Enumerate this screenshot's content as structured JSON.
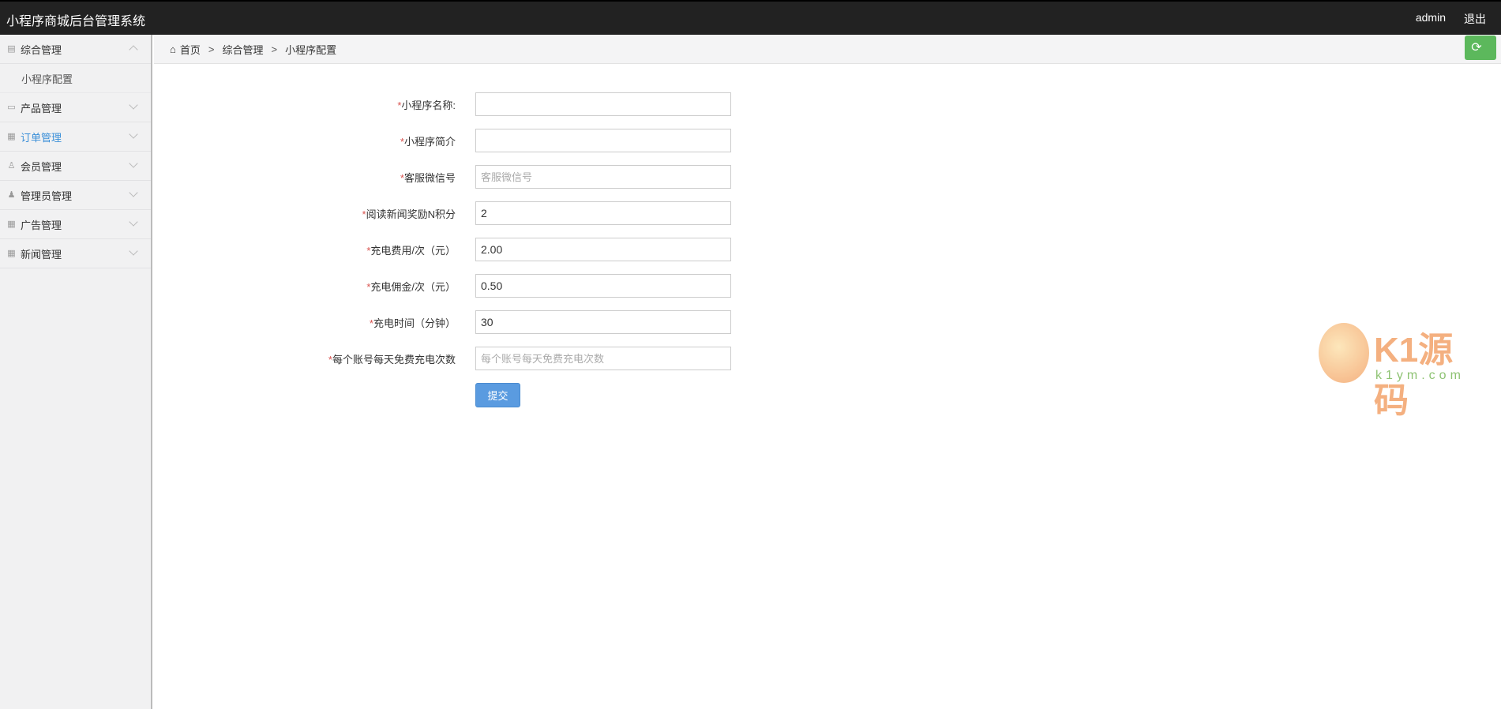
{
  "header": {
    "title": "小程序商城后台管理系统",
    "user": "admin",
    "logout": "退出"
  },
  "sidebar": {
    "items": [
      {
        "label": "综合管理",
        "icon": "list-icon",
        "expanded": true,
        "children": [
          "小程序配置"
        ]
      },
      {
        "label": "产品管理",
        "icon": "image-icon"
      },
      {
        "label": "订单管理",
        "icon": "table-icon",
        "active": true
      },
      {
        "label": "会员管理",
        "icon": "user-outline-icon"
      },
      {
        "label": "管理员管理",
        "icon": "user-icon"
      },
      {
        "label": "广告管理",
        "icon": "table-icon"
      },
      {
        "label": "新闻管理",
        "icon": "table-icon"
      }
    ]
  },
  "breadcrumb": {
    "home": "首页",
    "sep": ">",
    "level1": "综合管理",
    "level2": "小程序配置"
  },
  "form": {
    "fields": [
      {
        "label": "小程序名称:",
        "value": "",
        "placeholder": ""
      },
      {
        "label": "小程序简介",
        "value": "",
        "placeholder": ""
      },
      {
        "label": "客服微信号",
        "value": "",
        "placeholder": "客服微信号"
      },
      {
        "label": "阅读新闻奖励N积分",
        "value": "2",
        "placeholder": ""
      },
      {
        "label": "充电费用/次（元）",
        "value": "2.00",
        "placeholder": ""
      },
      {
        "label": "充电佣金/次（元）",
        "value": "0.50",
        "placeholder": ""
      },
      {
        "label": "充电时间（分钟）",
        "value": "30",
        "placeholder": ""
      },
      {
        "label": "每个账号每天免费充电次数",
        "value": "",
        "placeholder": "每个账号每天免费充电次数"
      }
    ],
    "required_mark": "*",
    "submit": "提交"
  },
  "watermark": {
    "name": "K1源码",
    "url": "k1ym.com"
  },
  "colors": {
    "accent": "#3a8fd8",
    "refresh": "#5cb85c",
    "submit": "#5a9be0",
    "required": "#d9534f"
  }
}
